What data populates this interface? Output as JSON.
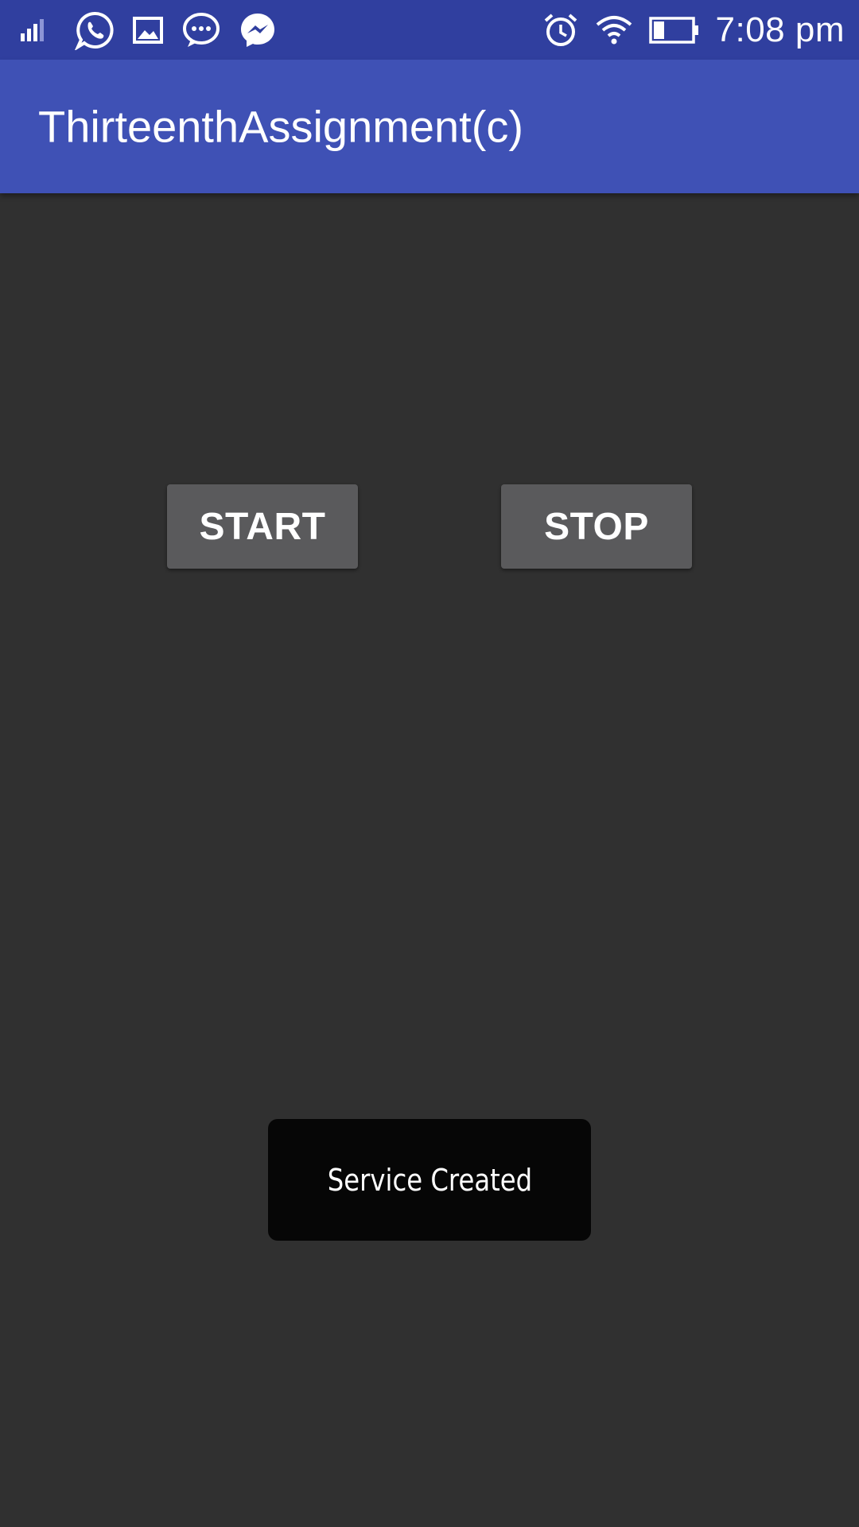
{
  "status_bar": {
    "time": "7:08 pm",
    "left_icons": [
      "signal-icon",
      "whatsapp-icon",
      "gallery-icon",
      "messages-icon",
      "messenger-icon"
    ],
    "right_icons": [
      "alarm-icon",
      "wifi-icon",
      "battery-icon"
    ],
    "sim_slot": "1",
    "background": "#303f9f"
  },
  "app_bar": {
    "title": "ThirteenthAssignment(c)",
    "background": "#3f51b5"
  },
  "main": {
    "background": "#303030",
    "start_label": "START",
    "stop_label": "STOP",
    "button_color": "#5a5a5c"
  },
  "toast": {
    "message": "Service Created",
    "background": "#060606"
  }
}
